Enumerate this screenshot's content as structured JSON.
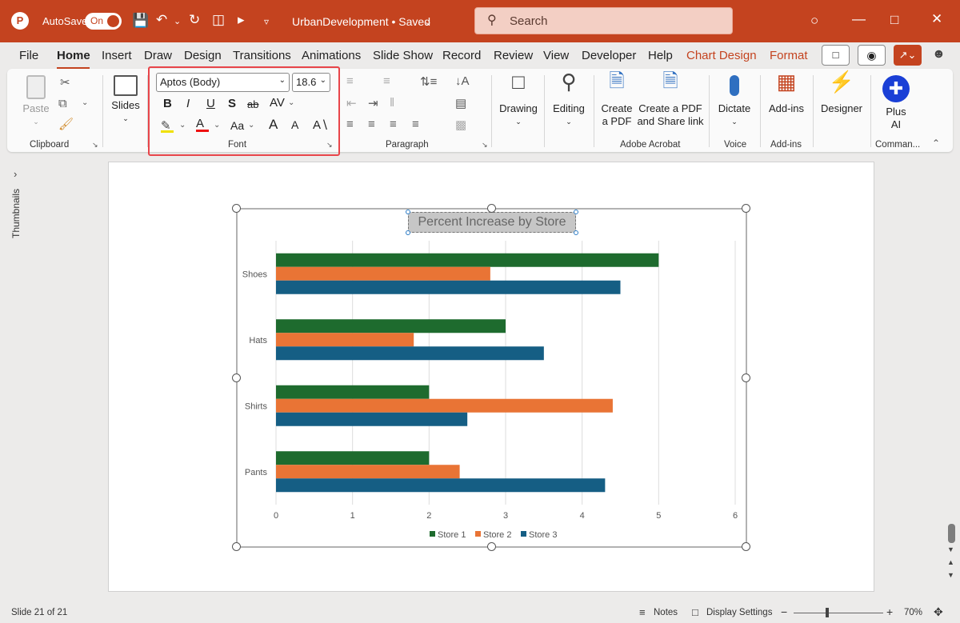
{
  "titlebar": {
    "autosave_label": "AutoSave",
    "autosave_state": "On",
    "document_title": "UrbanDevelopment • Saved",
    "search_placeholder": "Search"
  },
  "tabs": [
    "File",
    "Home",
    "Insert",
    "Draw",
    "Design",
    "Transitions",
    "Animations",
    "Slide Show",
    "Record",
    "Review",
    "View",
    "Developer",
    "Help",
    "Chart Design",
    "Format"
  ],
  "ribbon": {
    "clipboard": {
      "paste": "Paste",
      "label": "Clipboard"
    },
    "slides": {
      "label": "Slides"
    },
    "font": {
      "name": "Aptos (Body)",
      "size": "18.6",
      "label": "Font",
      "bold": "B",
      "italic": "I",
      "underline": "U",
      "shadow": "S",
      "strike": "ab",
      "spacing": "AV",
      "case": "Aa",
      "grow": "A",
      "shrink": "A"
    },
    "paragraph": {
      "label": "Paragraph"
    },
    "drawing": {
      "label": "Drawing"
    },
    "editing": {
      "label": "Editing"
    },
    "acrobat": {
      "create_pdf_1": "Create",
      "create_pdf_2": "a PDF",
      "share_1": "Create a PDF",
      "share_2": "and Share link",
      "label": "Adobe Acrobat"
    },
    "voice": {
      "dictate": "Dictate",
      "label": "Voice"
    },
    "addins": {
      "button": "Add-ins",
      "label": "Add-ins"
    },
    "designer": {
      "label": "Designer"
    },
    "plusai": {
      "line1": "Plus",
      "line2": "AI",
      "label": "Comman..."
    }
  },
  "thumbnails_label": "Thumbnails",
  "chart_data": {
    "type": "bar",
    "orientation": "horizontal",
    "title": "Percent Increase by Store",
    "categories": [
      "Shoes",
      "Hats",
      "Shirts",
      "Pants"
    ],
    "series": [
      {
        "name": "Store 1",
        "color": "#1e6b2e",
        "values": [
          5,
          3,
          2,
          2
        ]
      },
      {
        "name": "Store 2",
        "color": "#e97435",
        "values": [
          2.8,
          1.8,
          4.4,
          2.4
        ]
      },
      {
        "name": "Store 3",
        "color": "#155e84",
        "values": [
          4.5,
          3.5,
          2.5,
          4.3
        ]
      }
    ],
    "xticks": [
      "0",
      "1",
      "2",
      "3",
      "4",
      "5",
      "6"
    ],
    "xlim": [
      0,
      6
    ],
    "grid": true,
    "legend": "bottom"
  },
  "status": {
    "slide": "Slide 21 of 21",
    "notes": "Notes",
    "display": "Display Settings",
    "zoom": "70%",
    "zoom_minus": "−",
    "zoom_plus": "+"
  }
}
